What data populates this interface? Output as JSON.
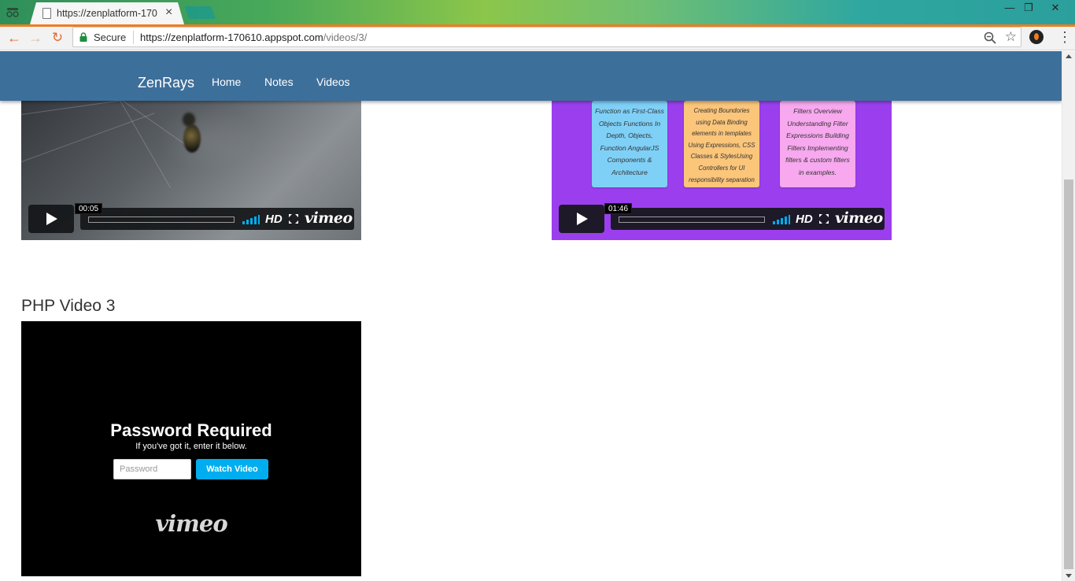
{
  "browser": {
    "tab_title": "https://zenplatform-170",
    "tab_close": "×",
    "secure_label": "Secure",
    "url_host": "https://zenplatform-170610.appspot.com",
    "url_path": "/videos/3/",
    "window_minimize": "—",
    "window_restore": "❐",
    "window_close": "✕"
  },
  "navbar": {
    "brand": "ZenRays",
    "links": [
      "Home",
      "Notes",
      "Videos"
    ]
  },
  "videos": [
    {
      "timecode": "00:05",
      "hd_label": "HD",
      "vimeo_label": "vimeo"
    },
    {
      "timecode": "01:46",
      "hd_label": "HD",
      "vimeo_label": "vimeo",
      "cards": [
        "Function as First-Class Objects Functions In Depth, Objects, Function AngularJS Components & Architecture",
        "Creating Boundories using Data Binding elements in templates Using Expressions, CSS Classes & StylesUsing Controllers for UI responsibility separation",
        "Filters Overview Understanding Filter Expressions Building Filters Implementing filters & custom filters in examples."
      ]
    },
    {
      "title": "PHP Video 3",
      "password_title": "Password Required",
      "password_subtitle": "If you've got it, enter it below.",
      "password_placeholder": "Password",
      "watch_button": "Watch Video",
      "vimeo_label": "vimeo"
    }
  ],
  "colors": {
    "navbar": "#3d6f9b",
    "vimeo_blue": "#00adef",
    "chrome_accent": "#f07c1f"
  }
}
